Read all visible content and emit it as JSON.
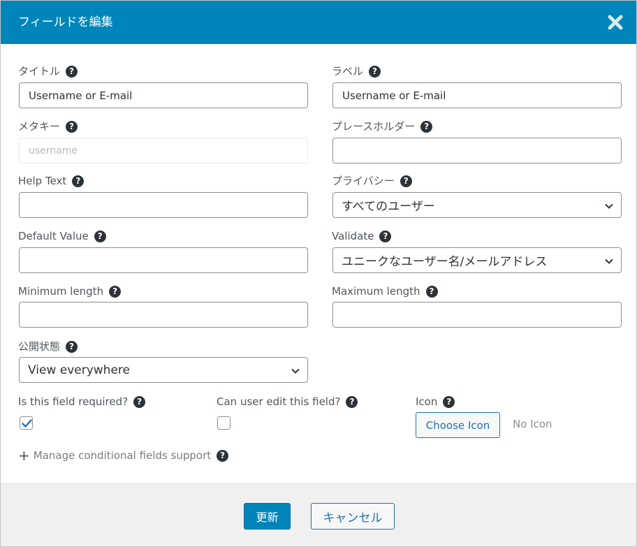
{
  "dialog": {
    "title": "フィールドを編集",
    "close_icon": "close-icon"
  },
  "fields": {
    "title": {
      "label": "タイトル",
      "value": "Username or E-mail"
    },
    "label": {
      "label": "ラベル",
      "value": "Username or E-mail"
    },
    "meta_key": {
      "label": "メタキー",
      "placeholder": "username"
    },
    "placeholder": {
      "label": "プレースホルダー",
      "value": ""
    },
    "help_text": {
      "label": "Help Text",
      "value": ""
    },
    "privacy": {
      "label": "プライバシー",
      "selected": "すべてのユーザー"
    },
    "default_value": {
      "label": "Default Value",
      "value": ""
    },
    "validate": {
      "label": "Validate",
      "selected": "ユニークなユーザー名/メールアドレス"
    },
    "min_length": {
      "label": "Minimum length",
      "value": ""
    },
    "max_length": {
      "label": "Maximum length",
      "value": ""
    },
    "visibility": {
      "label": "公開状態",
      "selected": "View everywhere"
    },
    "required": {
      "label": "Is this field required?",
      "checked": true
    },
    "editable": {
      "label": "Can user edit this field?",
      "checked": false
    },
    "icon": {
      "label": "Icon",
      "button": "Choose Icon",
      "status": "No Icon"
    }
  },
  "manage_conditional": {
    "plus": "+",
    "label": "Manage conditional fields support"
  },
  "help_glyph": "?",
  "footer": {
    "update": "更新",
    "cancel": "キャンセル"
  },
  "colors": {
    "header_bg": "#0085ba",
    "primary": "#0085ba",
    "link": "#2271b1"
  }
}
